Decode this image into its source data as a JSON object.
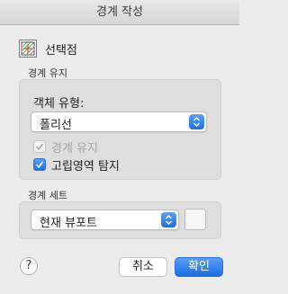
{
  "window": {
    "title": "경계 작성"
  },
  "pick_mode": {
    "label": "선택점",
    "icon": "pick-points-icon"
  },
  "boundary_retention": {
    "section_label": "경계 유지",
    "object_type_label": "객체 유형:",
    "object_type_value": "폴리선",
    "retain_boundaries": {
      "label": "경계 유지",
      "checked": true,
      "enabled": false
    },
    "island_detection": {
      "label": "고립영역 탐지",
      "checked": true,
      "enabled": true
    }
  },
  "boundary_set": {
    "section_label": "경계 세트",
    "value": "현재 뷰포트"
  },
  "footer": {
    "help_label": "?",
    "cancel_label": "취소",
    "ok_label": "확인"
  },
  "colors": {
    "accent": "#1d6fe6",
    "background": "#ececec",
    "group": "#dedede"
  }
}
